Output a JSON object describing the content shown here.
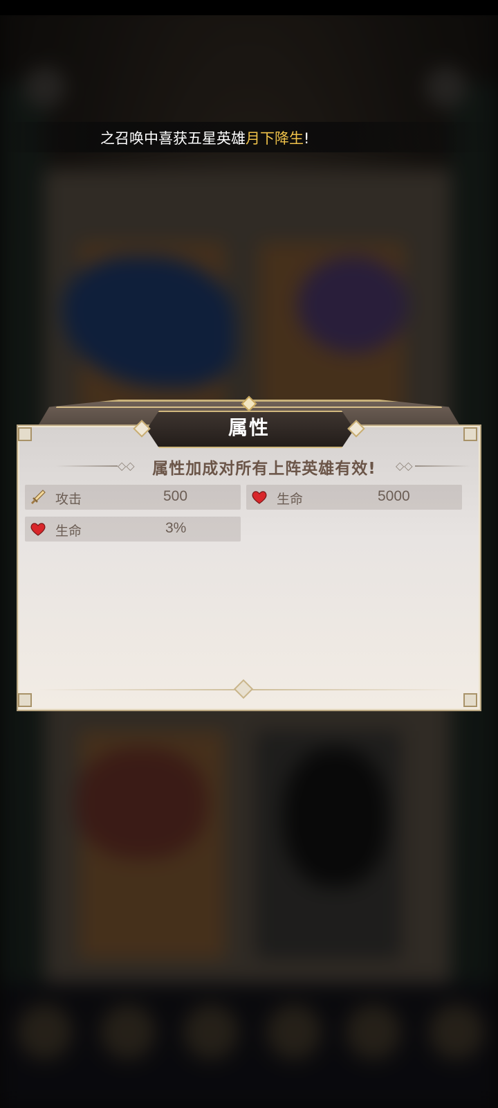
{
  "banner": {
    "prefix": "之召唤中喜获五星英雄",
    "hero_name": "月下降生",
    "suffix": "!"
  },
  "dialog": {
    "title": "属性",
    "subtitle": "属性加成对所有上阵英雄有效!",
    "stats": [
      {
        "icon": "sword-icon",
        "label": "攻击",
        "value": "500"
      },
      {
        "icon": "heart-icon",
        "label": "生命",
        "value": "5000"
      },
      {
        "icon": "heart-icon",
        "label": "生命",
        "value": "3%"
      }
    ]
  },
  "colors": {
    "highlight": "#f0c24a",
    "title_plate": "#2b2420",
    "text_brown": "#6b5548"
  }
}
